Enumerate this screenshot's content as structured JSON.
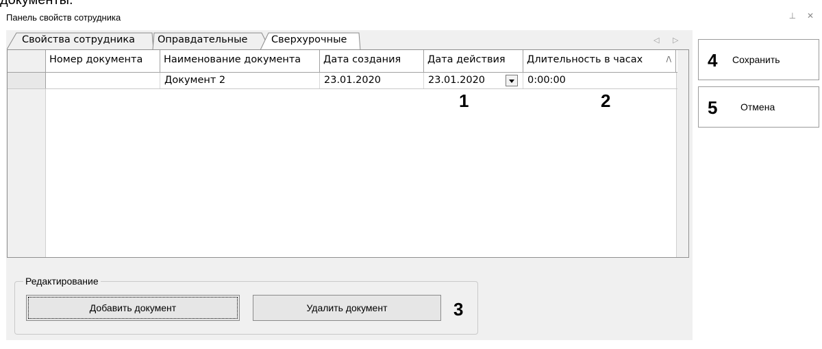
{
  "page_fragment": "документы.",
  "panel": {
    "title": "Панель свойств сотрудника",
    "title_icons": "⊥ ✕"
  },
  "tabs": [
    {
      "label": "Свойства сотрудника",
      "active": false
    },
    {
      "label": "Оправдательные",
      "active": false
    },
    {
      "label": "Сверхурочные",
      "active": true
    }
  ],
  "tab_scroll": "◁ ▷",
  "grid": {
    "columns": [
      "Номер документа",
      "Наименование документа",
      "Дата создания",
      "Дата действия",
      "Длительность в часах"
    ],
    "sort_indicator": "/\\",
    "rows": [
      {
        "number": "",
        "name": "Документ 2",
        "created": "23.01.2020",
        "effective": "23.01.2020",
        "duration": "0:00:00"
      }
    ]
  },
  "callouts": {
    "c1": "1",
    "c2": "2",
    "c3": "3"
  },
  "actions": {
    "save": {
      "num": "4",
      "label": "Сохранить"
    },
    "cancel": {
      "num": "5",
      "label": "Отмена"
    }
  },
  "editing": {
    "caption": "Редактирование",
    "add_label": "Добавить документ",
    "delete_label": "Удалить документ"
  },
  "colors": {
    "panel_bg": "#f0f0f0",
    "grid_border": "#8f8f8f",
    "active_tab": "#ffffff"
  }
}
